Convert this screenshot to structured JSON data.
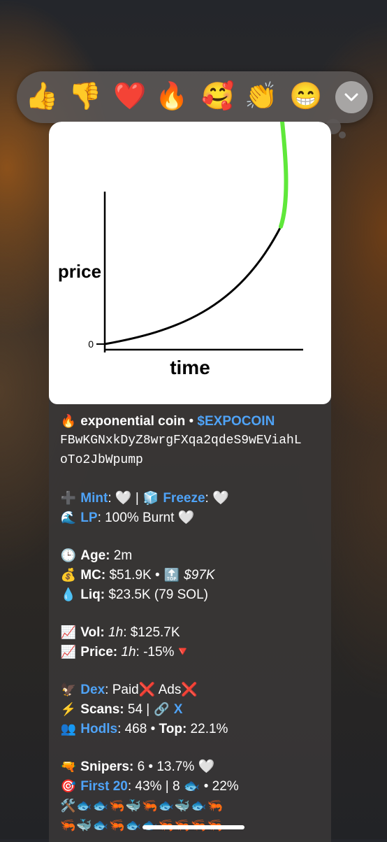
{
  "reactions": [
    {
      "name": "thumbs-up",
      "glyph": "👍"
    },
    {
      "name": "thumbs-down",
      "glyph": "👎"
    },
    {
      "name": "red-heart",
      "glyph": "❤️"
    },
    {
      "name": "fire",
      "glyph": "🔥"
    },
    {
      "name": "smiling-face-with-hearts",
      "glyph": "🥰"
    },
    {
      "name": "clapping-hands",
      "glyph": "👏"
    },
    {
      "name": "grinning-face",
      "glyph": "😁"
    }
  ],
  "expand_icon": "chevron-down-icon",
  "media": {
    "ylabel": "price",
    "xlabel": "time",
    "zero_tick": "0",
    "curve_color": "#000000",
    "highlight_color": "#5fe83a"
  },
  "message": {
    "title_emoji": "🔥",
    "name": "exponential coin",
    "sep1": " • ",
    "ticker": "$EXPOCOIN",
    "address_line1": "FBwKGNxkDyZ8wrgFXqa2qdeS9wEViahL",
    "address_line2": "oTo2JbWpump",
    "mint_icon": "➕",
    "mint_label": "Mint",
    "mint_value": ": 🤍 | ",
    "freeze_icon": "🧊",
    "freeze_label": "Freeze",
    "freeze_value": ": 🤍",
    "lp_icon": "🌊",
    "lp_label": "LP",
    "lp_value": ": 100% Burnt 🤍",
    "age_icon": "🕒",
    "age_label": "Age:",
    "age_value": " 2m",
    "mc_icon": "💰",
    "mc_label": "MC:",
    "mc_value": " $51.9K • ",
    "top_icon": "🔝",
    "ath_value": "$97K",
    "liq_icon": "💧",
    "liq_label": "Liq:",
    "liq_value": " $23.5K (79 SOL)",
    "vol_icon": "📈",
    "vol_label": "Vol:",
    "vol_period": "1h",
    "vol_value": ": $125.7K",
    "price_icon": "📈",
    "price_label": "Price:",
    "price_period": "1h",
    "price_value": ": -15%",
    "price_trend_icon": "🔻",
    "dex_icon": "🦅",
    "dex_label": "Dex",
    "dex_value": ": Paid",
    "dex_paid_icon": "❌",
    "ads_value": " Ads",
    "ads_icon": "❌",
    "scans_icon": "⚡",
    "scans_label": "Scans:",
    "scans_value": " 54 | ",
    "link_icon": "🔗",
    "x_link": "X",
    "hodls_icon": "👥",
    "hodls_label": "Hodls",
    "hodls_value": ": 468 • ",
    "top_label": "Top:",
    "top_value": " 22.1%",
    "snipers_icon": "🔫",
    "snipers_label": "Snipers:",
    "snipers_value": " 6 • 13.7% 🤍",
    "first_icon": "🎯",
    "first_label": "First 20",
    "first_value": ": 43% | 8 🐟 • 22%",
    "holders_row1": "🛠️🐟🐟🦐🐳🦐🐟🐳🐟🦐",
    "holders_row2": "🦐🐳🐟🦐🐟🐟🦐🦐🦐🦐"
  }
}
